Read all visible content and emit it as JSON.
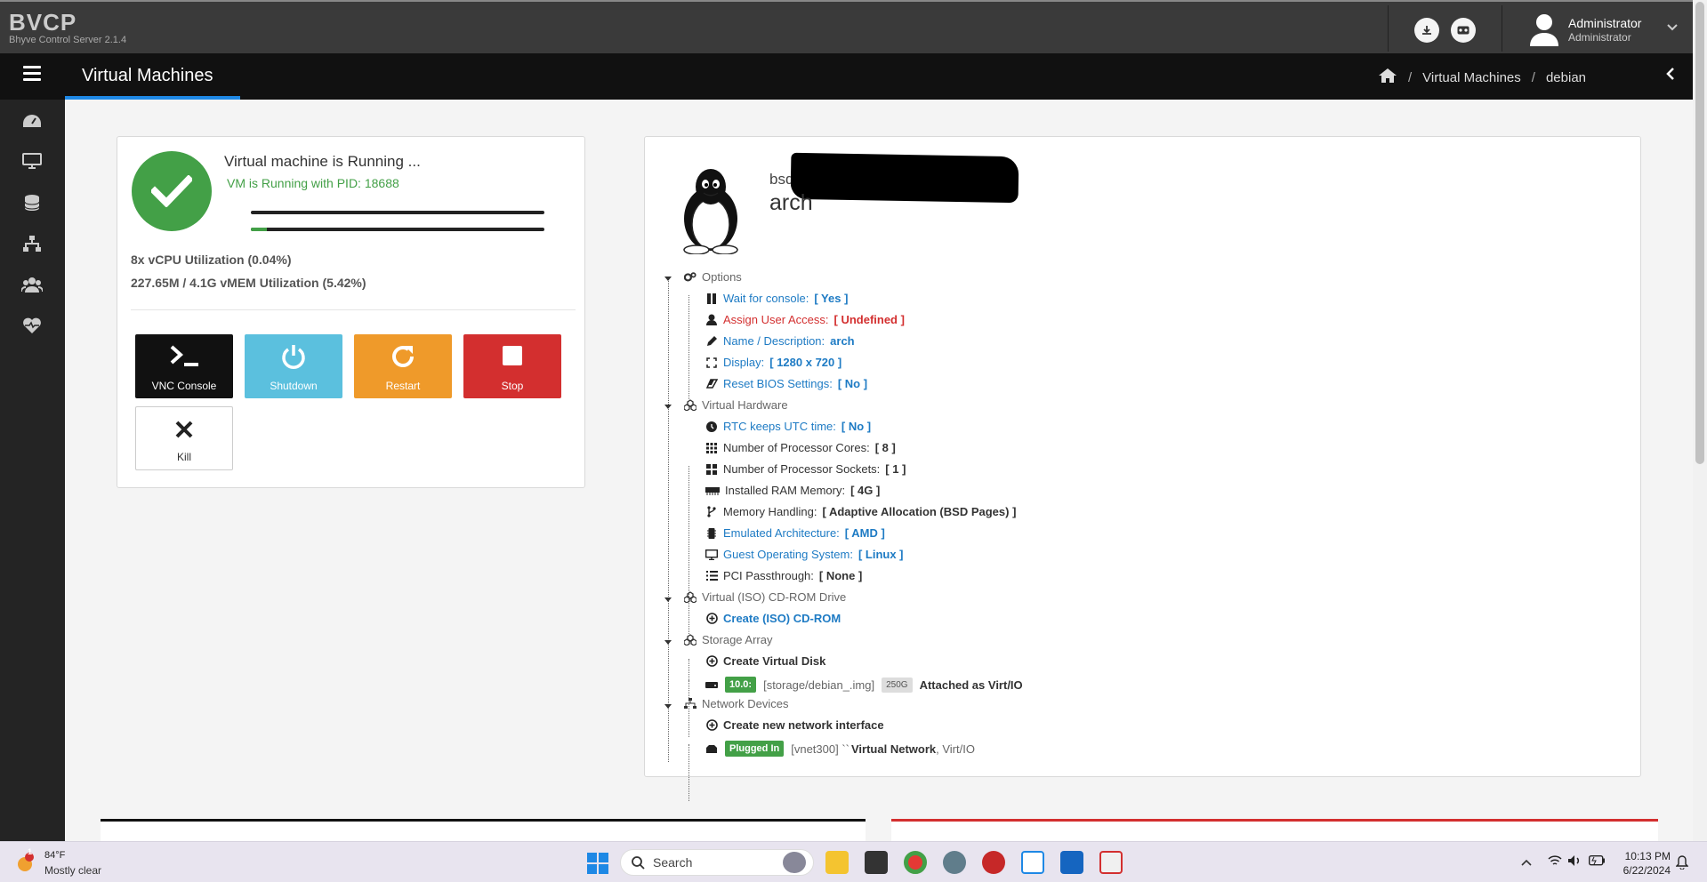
{
  "brand": {
    "title": "BVCP",
    "subtitle": "Bhyve Control Server 2.1.4"
  },
  "user": {
    "name": "Administrator",
    "role": "Administrator"
  },
  "navbar": {
    "page_title": "Virtual Machines",
    "breadcrumb": [
      "Virtual Machines",
      "debian"
    ]
  },
  "sidebar": {
    "items": [
      "dashboard-icon",
      "monitor-icon",
      "database-icon",
      "network-icon",
      "users-icon",
      "heartbeat-icon"
    ]
  },
  "status": {
    "title": "Virtual machine is Running ...",
    "subtitle": "VM is Running with PID: 18688",
    "cpu_util": "8x vCPU Utilization (0.04%)",
    "mem_util": "227.65M / 4.1G vMEM Utilization (5.42%)",
    "mem_fraction": 0.0542,
    "actions": {
      "vnc": "VNC Console",
      "shutdown": "Shutdown",
      "restart": "Restart",
      "stop": "Stop",
      "kill": "Kill"
    }
  },
  "vm": {
    "os_prefix": "bsd",
    "os_name": "arch",
    "options": {
      "label": "Options",
      "wait_console": "Wait for console:",
      "wait_console_val": "[ Yes ]",
      "assign_user": "Assign User Access:",
      "assign_user_val": "[ Undefined ]",
      "name_desc": "Name / Description:",
      "name_desc_val": "arch",
      "display": "Display:",
      "display_val": "[ 1280 x 720 ]",
      "reset_bios": "Reset BIOS Settings:",
      "reset_bios_val": "[ No ]"
    },
    "hardware": {
      "label": "Virtual Hardware",
      "rtc": "RTC keeps UTC time:",
      "rtc_val": "[ No ]",
      "cores": "Number of Processor Cores:",
      "cores_val": "[ 8 ]",
      "sockets": "Number of Processor Sockets:",
      "sockets_val": "[ 1 ]",
      "ram": "Installed RAM Memory:",
      "ram_val": "[ 4G ]",
      "mem_handling": "Memory Handling:",
      "mem_handling_val": "[ Adaptive Allocation (BSD Pages) ]",
      "arch": "Emulated Architecture:",
      "arch_val": "[ AMD ]",
      "guest_os": "Guest Operating System:",
      "guest_os_val": "[ Linux ]",
      "pci": "PCI Passthrough:",
      "pci_val": "[ None ]"
    },
    "cdrom": {
      "label": "Virtual (ISO) CD-ROM Drive",
      "create": "Create (ISO) CD-ROM"
    },
    "storage": {
      "label": "Storage Array",
      "create": "Create Virtual Disk",
      "disk_badge": "10.0:",
      "disk_path": "[storage/debian_.img]",
      "disk_size": "250G",
      "disk_attach": "Attached as Virt/IO"
    },
    "network": {
      "label": "Network Devices",
      "create": "Create new network interface",
      "nic_badge": "Plugged In",
      "nic_name": "[vnet300] ``",
      "nic_net": "Virtual Network",
      "nic_type": ", Virt/IO"
    }
  },
  "taskbar": {
    "weather_temp": "84°F",
    "weather_desc": "Mostly clear",
    "weather_badge": "1",
    "search": "Search",
    "time": "10:13 PM",
    "date": "6/22/2024"
  },
  "colors": {
    "green": "#43a047",
    "blue": "#1e88e5",
    "orange": "#ef9a2a",
    "red": "#d32f2f",
    "cyan": "#5bc0de"
  }
}
